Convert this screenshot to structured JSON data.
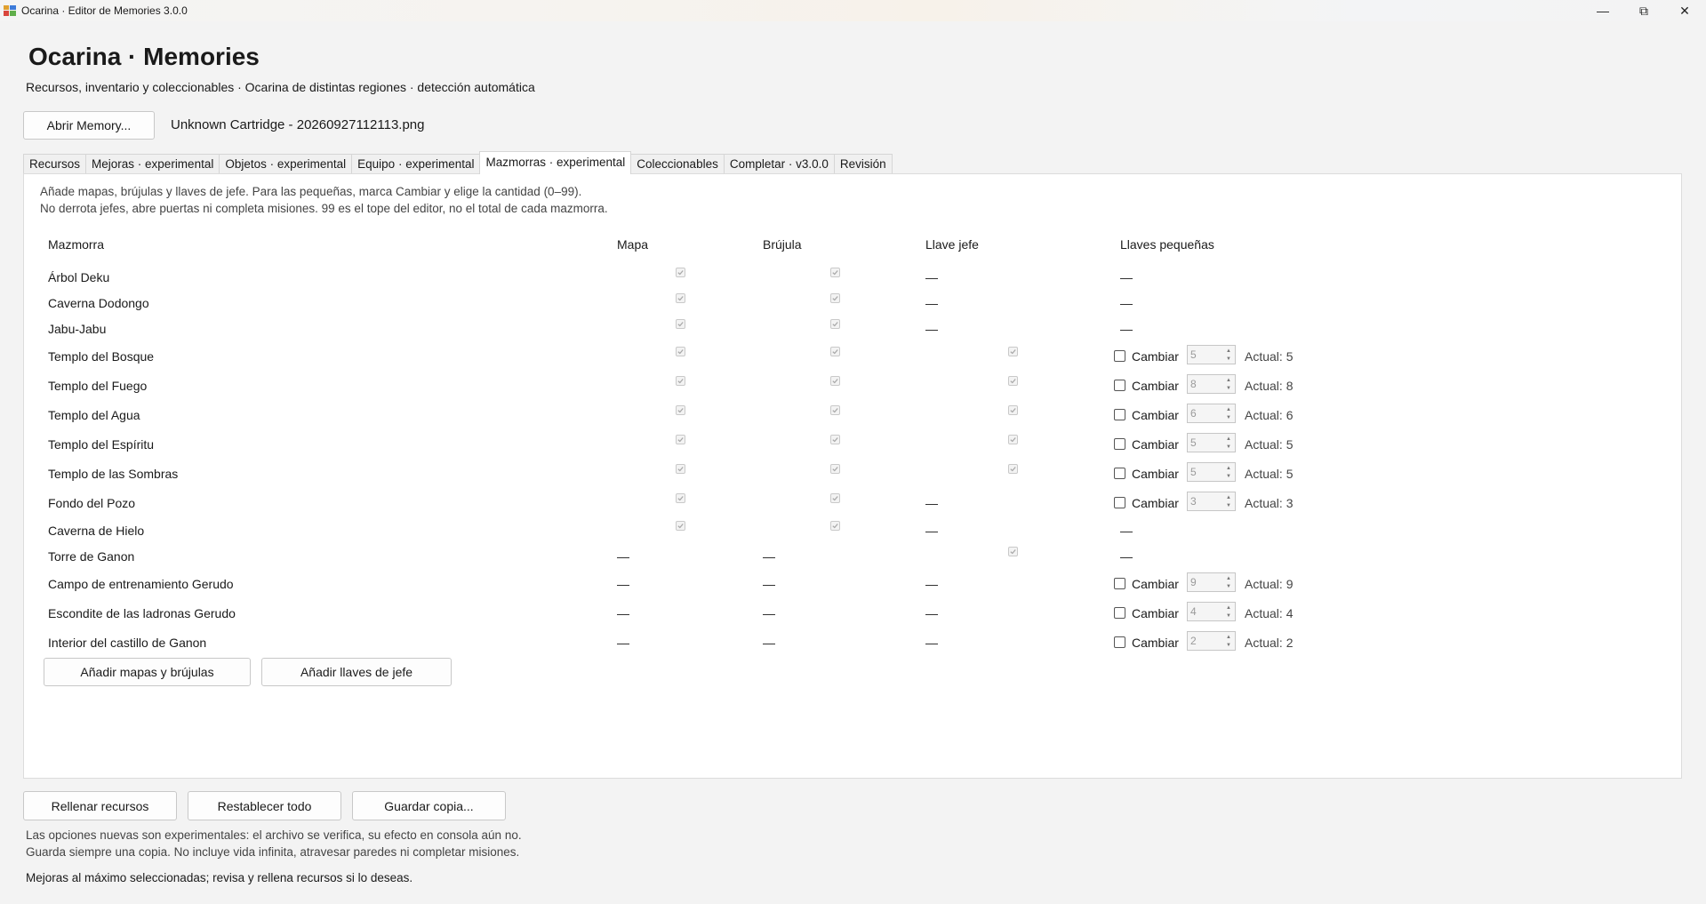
{
  "window": {
    "title": "Ocarina · Editor de Memories 3.0.0",
    "minimize_glyph": "—",
    "maximize_glyph": "⧉",
    "close_glyph": "✕"
  },
  "header": {
    "title": "Ocarina · Memories",
    "subtitle": "Recursos, inventario y coleccionables · Ocarina de distintas regiones · detección automática"
  },
  "file": {
    "open_button": "Abrir Memory...",
    "loaded": "Unknown Cartridge - 20260927112113.png"
  },
  "tabs": [
    {
      "label": "Recursos",
      "active": false
    },
    {
      "label": "Mejoras · experimental",
      "active": false
    },
    {
      "label": "Objetos · experimental",
      "active": false
    },
    {
      "label": "Equipo · experimental",
      "active": false
    },
    {
      "label": "Mazmorras · experimental",
      "active": true
    },
    {
      "label": "Coleccionables",
      "active": false
    },
    {
      "label": "Completar · v3.0.0",
      "active": false
    },
    {
      "label": "Revisión",
      "active": false
    }
  ],
  "dungeons_panel": {
    "hint_1": "Añade mapas, brújulas y llaves de jefe. Para las pequeñas, marca Cambiar y elige la cantidad (0–99).",
    "hint_2": "No derrota jefes, abre puertas ni completa misiones. 99 es el tope del editor, no el total de cada mazmorra.",
    "headers": {
      "dungeon": "Mazmorra",
      "map": "Mapa",
      "compass": "Brújula",
      "boss_key": "Llave jefe",
      "small_keys": "Llaves pequeñas"
    },
    "dash": "—",
    "change_label": "Cambiar",
    "rows": [
      {
        "name": "Árbol Deku",
        "map": true,
        "compass": true,
        "boss_key": null,
        "small_keys": null
      },
      {
        "name": "Caverna Dodongo",
        "map": true,
        "compass": true,
        "boss_key": null,
        "small_keys": null
      },
      {
        "name": "Jabu-Jabu",
        "map": true,
        "compass": true,
        "boss_key": null,
        "small_keys": null
      },
      {
        "name": "Templo del Bosque",
        "map": true,
        "compass": true,
        "boss_key": true,
        "small_keys": {
          "value": "5",
          "actual": "Actual: 5"
        }
      },
      {
        "name": "Templo del Fuego",
        "map": true,
        "compass": true,
        "boss_key": true,
        "small_keys": {
          "value": "8",
          "actual": "Actual: 8"
        }
      },
      {
        "name": "Templo del Agua",
        "map": true,
        "compass": true,
        "boss_key": true,
        "small_keys": {
          "value": "6",
          "actual": "Actual: 6"
        }
      },
      {
        "name": "Templo del Espíritu",
        "map": true,
        "compass": true,
        "boss_key": true,
        "small_keys": {
          "value": "5",
          "actual": "Actual: 5"
        }
      },
      {
        "name": "Templo de las Sombras",
        "map": true,
        "compass": true,
        "boss_key": true,
        "small_keys": {
          "value": "5",
          "actual": "Actual: 5"
        }
      },
      {
        "name": "Fondo del Pozo",
        "map": true,
        "compass": true,
        "boss_key": null,
        "small_keys": {
          "value": "3",
          "actual": "Actual: 3"
        }
      },
      {
        "name": "Caverna de Hielo",
        "map": true,
        "compass": true,
        "boss_key": null,
        "small_keys": null
      },
      {
        "name": "Torre de Ganon",
        "map": null,
        "compass": null,
        "boss_key": true,
        "small_keys": null
      },
      {
        "name": "Campo de entrenamiento Gerudo",
        "map": null,
        "compass": null,
        "boss_key": null,
        "small_keys": {
          "value": "9",
          "actual": "Actual: 9"
        }
      },
      {
        "name": "Escondite de las ladronas Gerudo",
        "map": null,
        "compass": null,
        "boss_key": null,
        "small_keys": {
          "value": "4",
          "actual": "Actual: 4"
        }
      },
      {
        "name": "Interior del castillo de Ganon",
        "map": null,
        "compass": null,
        "boss_key": null,
        "small_keys": {
          "value": "2",
          "actual": "Actual: 2"
        }
      }
    ],
    "add_maps_button": "Añadir mapas y brújulas",
    "add_boss_keys_button": "Añadir llaves de jefe"
  },
  "footer": {
    "fill_button": "Rellenar recursos",
    "reset_button": "Restablecer todo",
    "save_button": "Guardar copia...",
    "note_1": "Las opciones nuevas son experimentales: el archivo se verifica, su efecto en consola aún no.",
    "note_2": "Guarda siempre una copia. No incluye vida infinita, atravesar paredes ni completar misiones.",
    "status": "Mejoras al máximo seleccionadas; revisa y rellena recursos si lo deseas."
  }
}
